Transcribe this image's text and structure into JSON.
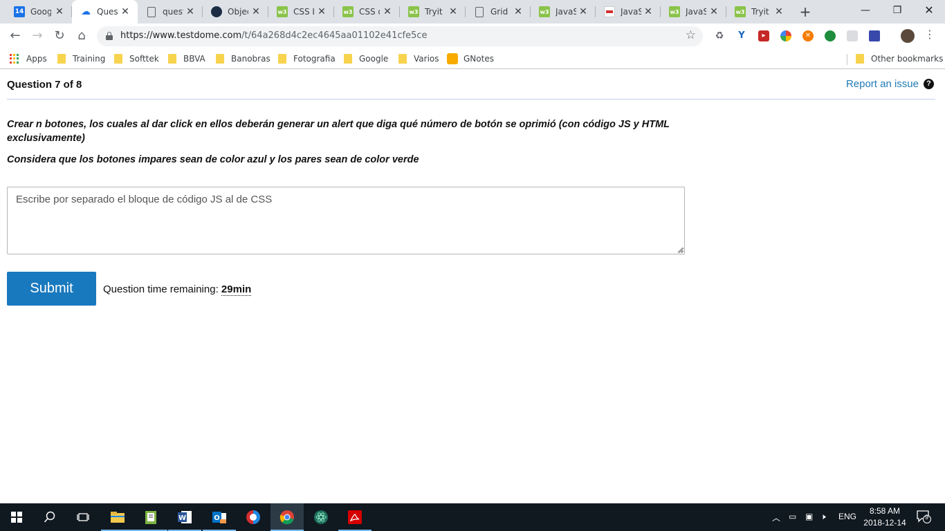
{
  "browser": {
    "tabs": [
      {
        "title": "Goog",
        "icon": "calendar-icon",
        "badge": "14",
        "active": false
      },
      {
        "title": "Quest",
        "icon": "cloud-icon",
        "active": true
      },
      {
        "title": "quest",
        "icon": "document-icon",
        "active": false
      },
      {
        "title": "Objec",
        "icon": "object-icon",
        "active": false
      },
      {
        "title": "CSS L",
        "icon": "w3schools-icon",
        "badge": "w3",
        "active": false
      },
      {
        "title": "CSS d",
        "icon": "w3schools-icon",
        "badge": "w3",
        "active": false
      },
      {
        "title": "Tryit E",
        "icon": "w3schools-icon",
        "badge": "w3",
        "active": false
      },
      {
        "title": "Grid b",
        "icon": "document-icon",
        "active": false
      },
      {
        "title": "JavaS",
        "icon": "w3schools-icon",
        "badge": "w3",
        "active": false
      },
      {
        "title": "JavaS",
        "icon": "red-flag-icon",
        "active": false
      },
      {
        "title": "JavaS",
        "icon": "w3schools-icon",
        "badge": "w3",
        "active": false
      },
      {
        "title": "Tryit E",
        "icon": "w3schools-icon",
        "badge": "w3",
        "active": false
      }
    ],
    "url_host": "https://www.testdome.com",
    "url_path": "/t/64a268d4c2ec4645aa01102e41cfe5ce",
    "bookmarks": [
      {
        "label": "Apps",
        "icon": "apps-grid-icon"
      },
      {
        "label": "Training",
        "icon": "folder-icon"
      },
      {
        "label": "Softtek",
        "icon": "folder-icon"
      },
      {
        "label": "BBVA",
        "icon": "folder-icon"
      },
      {
        "label": "Banobras",
        "icon": "folder-icon"
      },
      {
        "label": "Fotografia",
        "icon": "folder-icon"
      },
      {
        "label": "Google",
        "icon": "folder-icon"
      },
      {
        "label": "Varios",
        "icon": "folder-icon"
      },
      {
        "label": "GNotes",
        "icon": "bulb-icon"
      }
    ],
    "other_bookmarks": "Other bookmarks"
  },
  "page": {
    "question_label": "Question 7 of 8",
    "report_link": "Report an issue",
    "help_glyph": "?",
    "prompt_line_1": "Crear n botones, los cuales al dar click en ellos deberán generar un alert que diga qué número de botón se oprimió  (con código JS y HTML exclusivamente)",
    "prompt_line_2": "Considera que los botones impares sean de color azul y los pares sean de color verde",
    "answer_placeholder": "Escribe por separado el bloque de código JS al de CSS",
    "answer_value": "",
    "submit_label": "Submit",
    "timer_label": "Question time remaining: ",
    "timer_value": "29min"
  },
  "taskbar": {
    "apps": [
      "windows-start-icon",
      "search-icon",
      "task-view-icon",
      "file-explorer-icon",
      "notepad-icon",
      "word-icon",
      "outlook-icon",
      "opera-icon",
      "chrome-icon",
      "atom-icon",
      "acrobat-icon"
    ],
    "active_app": "chrome-icon",
    "language": "ENG",
    "time": "8:58 AM",
    "date": "2018-12-14",
    "notifications": "9"
  },
  "colors": {
    "accent_blue": "#1979be",
    "link_blue": "#1f7ab5",
    "w3_green": "#8ac34a"
  }
}
